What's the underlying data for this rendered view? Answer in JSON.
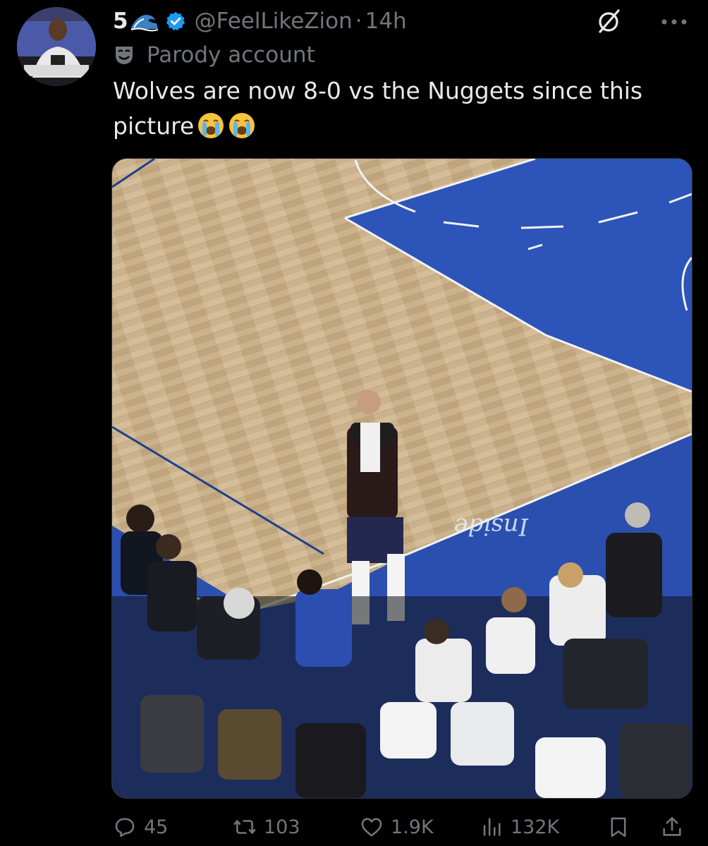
{
  "author": {
    "display_name": "5",
    "name_emoji_icon": "water-wave-icon",
    "verified_icon": "verified-badge-icon",
    "handle": "@FeelLikeZion",
    "separator": "·",
    "timestamp": "14h",
    "label_icon": "parody-mask-icon",
    "label": "Parody account"
  },
  "tweet": {
    "text": "Wolves are now 8-0 vs the Nuggets since this picture",
    "emojis": [
      "loudly-crying-face-icon",
      "loudly-crying-face-icon"
    ]
  },
  "actions": {
    "replies": "45",
    "retweets": "103",
    "likes": "1.9K",
    "views": "132K"
  },
  "colors": {
    "background": "#000000",
    "text_primary": "#e7e9ea",
    "text_secondary": "#71767b",
    "verified": "#1d9bf0"
  }
}
